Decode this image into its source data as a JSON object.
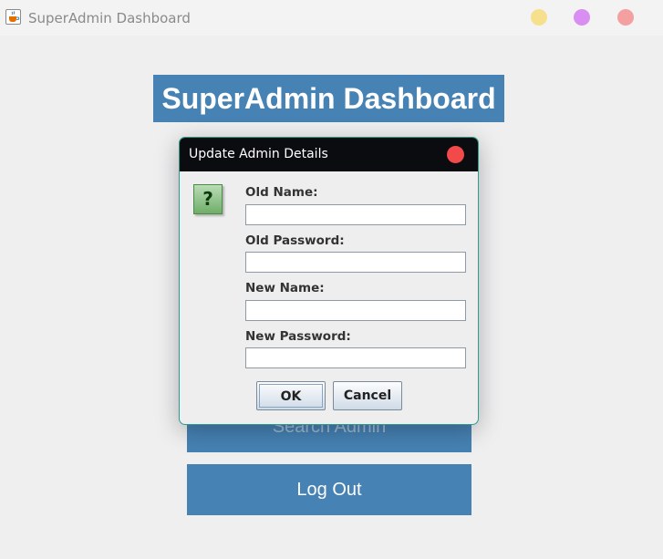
{
  "window": {
    "title": "SuperAdmin Dashboard",
    "icon": "java-cup-icon",
    "controls": [
      "minimize-button",
      "maximize-button",
      "close-button"
    ],
    "control_colors": {
      "minimize": "#f7e08d",
      "maximize": "#d98ff2",
      "close": "#f4a0a0"
    }
  },
  "main": {
    "heading": "SuperAdmin Dashboard",
    "buttons": {
      "search": "Search Admin",
      "logout": "Log Out"
    },
    "accent": "#4682b4"
  },
  "dialog": {
    "title": "Update Admin Details",
    "icon": "question-icon",
    "icon_glyph": "?",
    "fields": [
      {
        "label": "Old Name:",
        "value": ""
      },
      {
        "label": "Old Password:",
        "value": ""
      },
      {
        "label": "New Name:",
        "value": ""
      },
      {
        "label": "New Password:",
        "value": ""
      }
    ],
    "ok_label": "OK",
    "cancel_label": "Cancel",
    "header_color": "#0b0c10",
    "close_color": "#f24a4a"
  }
}
